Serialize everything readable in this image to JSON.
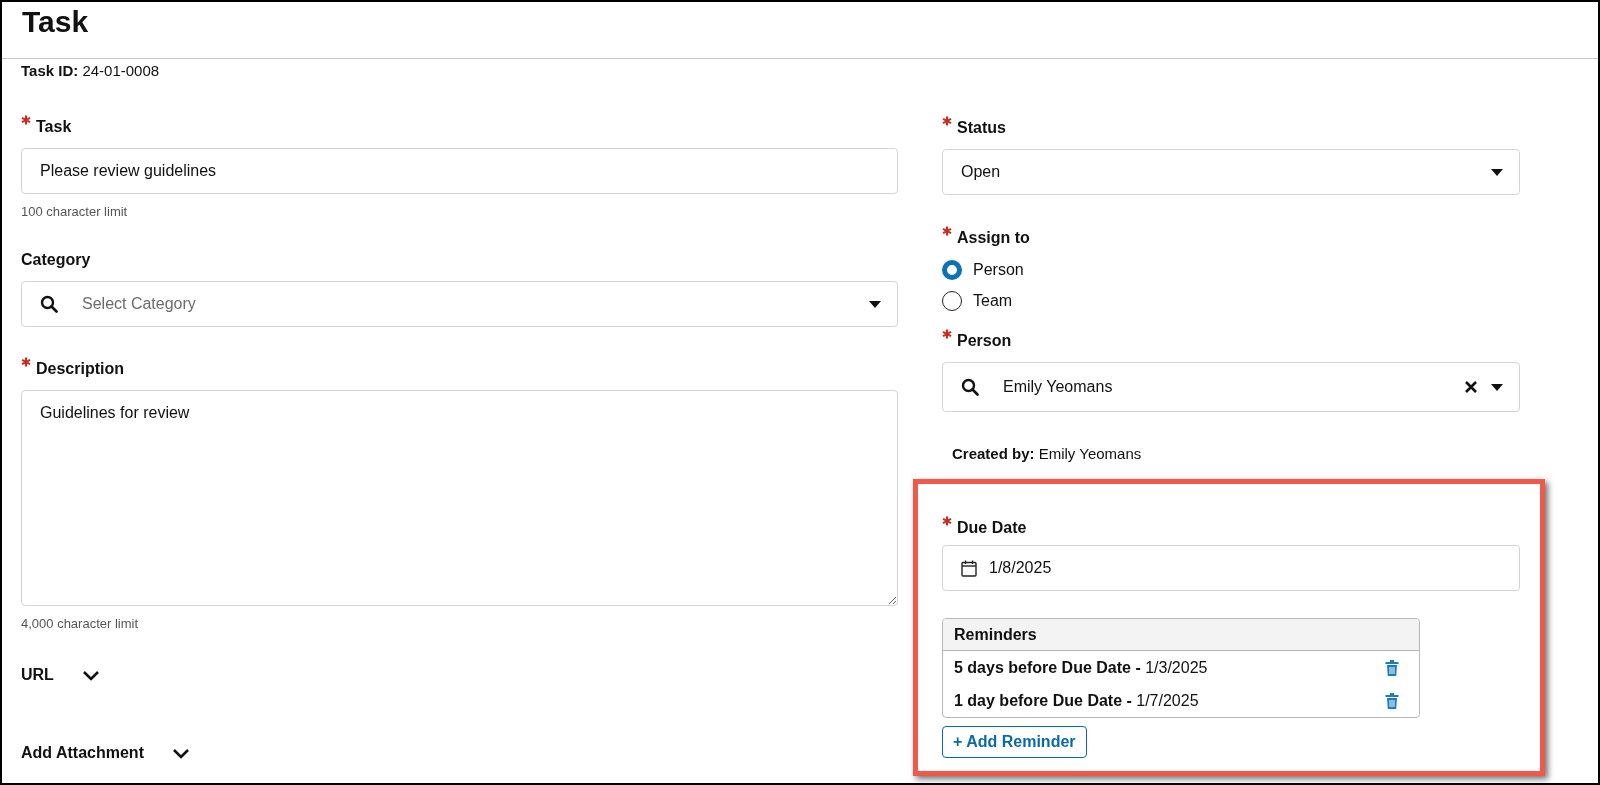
{
  "window": {
    "title": "Task"
  },
  "task_id": "**Task ID:** 24-01-0008",
  "left_fields": [
    {
      "kind": "text",
      "label": "Task",
      "required": true,
      "value": "Please review guidelines",
      "hint": "100 character limit"
    },
    {
      "kind": "search_select",
      "label": "Category",
      "required": false,
      "placeholder": "Select Category"
    },
    {
      "kind": "textarea",
      "label": "Description",
      "required": true,
      "value": "Guidelines for review",
      "hint": "4,000 character limit"
    }
  ],
  "sections": [
    {
      "label": "URL",
      "expanded": false
    },
    {
      "label": "Add Attachment",
      "expanded": false
    }
  ],
  "right_fields": [
    {
      "kind": "select",
      "label": "Status",
      "required": true,
      "value": "Open"
    },
    {
      "kind": "radio",
      "label": "Assign to",
      "required": true,
      "options": [
        {
          "label": "Person",
          "selected": true
        },
        {
          "label": "Team",
          "selected": false
        }
      ]
    },
    {
      "kind": "search_select",
      "label": "Person",
      "required": true,
      "value": "Emily Yeomans",
      "clearable": true
    }
  ],
  "created_by": "**Created by:** Emily Yeomans",
  "due_date": {
    "highlighted": true,
    "label": "Due Date",
    "required": true,
    "value": "1/8/2025"
  },
  "reminders": {
    "title": "Reminders",
    "rows": [
      {
        "text": "**5 days before Due Date -** 1/3/2025"
      },
      {
        "text": "**1 day before Due Date -** 1/7/2025"
      }
    ],
    "add_button": "+ Add Reminder"
  }
}
